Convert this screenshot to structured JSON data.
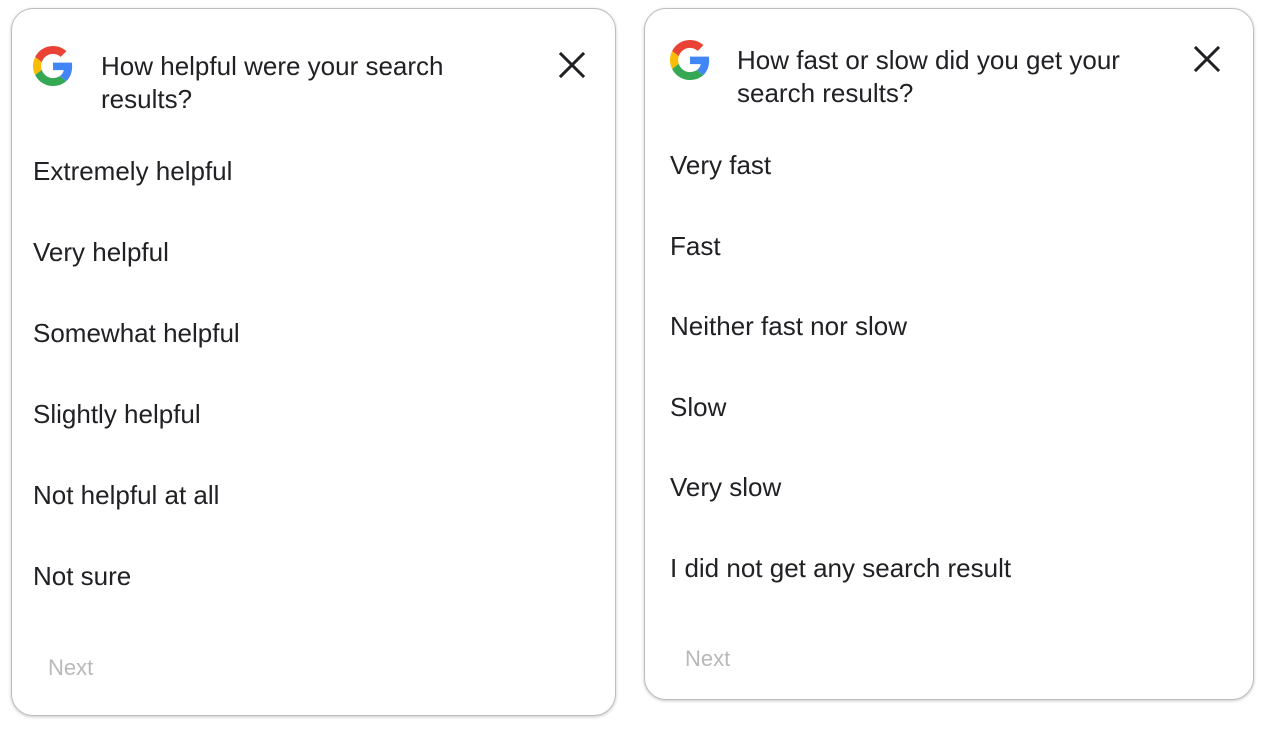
{
  "surveys": [
    {
      "question": "How helpful were your search results?",
      "options": [
        "Extremely helpful",
        "Very helpful",
        "Somewhat helpful",
        "Slightly helpful",
        "Not helpful at all",
        "Not sure"
      ],
      "next_label": "Next"
    },
    {
      "question": "How fast or slow did you get your search results?",
      "options": [
        "Very fast",
        "Fast",
        "Neither fast nor slow",
        "Slow",
        "Very slow",
        "I did not get any search result"
      ],
      "next_label": "Next"
    }
  ],
  "colors": {
    "text": "#202124",
    "next_disabled": "#b9b9b9",
    "border": "#bdbdbd",
    "google_blue": "#4285F4",
    "google_red": "#EA4335",
    "google_yellow": "#FBBC05",
    "google_green": "#34A853"
  },
  "icons": {
    "logo": "google-g-icon",
    "close": "close-icon"
  }
}
